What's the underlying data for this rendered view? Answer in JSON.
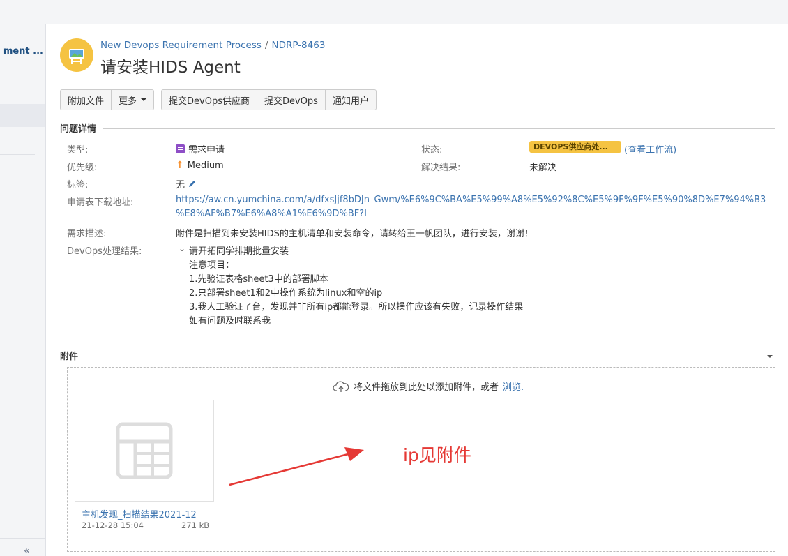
{
  "sidebar": {
    "project_name": "ment ...",
    "collapse_label": "«"
  },
  "breadcrumb": {
    "project": "New Devops Requirement Process",
    "separator": "/",
    "issue_key": "NDRP-8463"
  },
  "issue": {
    "title": "请安装HIDS Agent"
  },
  "toolbar": {
    "attach": "附加文件",
    "more": "更多",
    "submit_vendor": "提交DevOps供应商",
    "submit_devops": "提交DevOps",
    "notify_user": "通知用户"
  },
  "details": {
    "heading": "问题详情",
    "type_label": "类型:",
    "type_value": "需求申请",
    "priority_label": "优先级:",
    "priority_value": "Medium",
    "labels_label": "标签:",
    "labels_value": "无",
    "download_label": "申请表下载地址:",
    "download_url_line1": "https://aw.cn.yumchina.com/a/dfxsJjf8bDJn_Gwm/%E6%9C%BA%E5%99%A8%E5%92%8C%E5%9F%9F%E5%90%8D%E7%94%B3",
    "download_url_line2": "%E8%AF%B7%E6%A8%A1%E6%9D%BF?I",
    "desc_label": "需求描述:",
    "desc_value": "附件是扫描到未安装HIDS的主机清单和安装命令，请转给王一帆团队，进行安装，谢谢！",
    "result_label": "DevOps处理结果:",
    "result_lines": [
      "请开拓同学排期批量安装",
      "注意项目：",
      "1.先验证表格sheet3中的部署脚本",
      "2.只部署sheet1和2中操作系统为linux和空的ip",
      "3.我人工验证了台，发现并非所有ip都能登录。所以操作应该有失败，记录操作结果",
      "如有问题及时联系我"
    ],
    "status_label": "状态:",
    "status_value": "DEVOPS供应商处...",
    "workflow_link": "(查看工作流)",
    "resolution_label": "解决结果:",
    "resolution_value": "未解决"
  },
  "attachments": {
    "heading": "附件",
    "drop_text": "将文件拖放到此处以添加附件，或者",
    "browse_link": "浏览.",
    "file": {
      "name": "主机发现_扫描结果2021-12",
      "date": "21-12-28 15:04",
      "size": "271 kB"
    }
  },
  "annotation": {
    "text": "ip见附件",
    "color": "#e53935"
  },
  "colors": {
    "link": "#3b73af",
    "status_lozenge": "#f5c342",
    "type_icon": "#8e4ec6",
    "priority_arrow": "#f79232"
  }
}
